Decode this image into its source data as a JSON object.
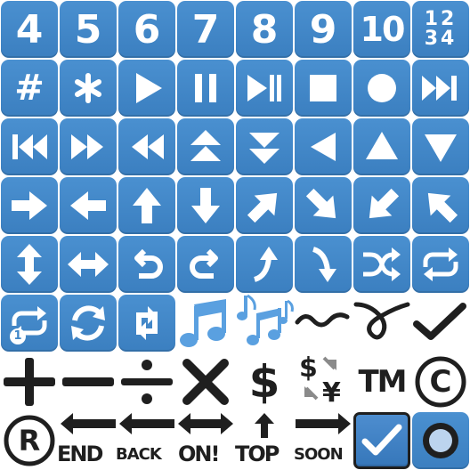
{
  "keycaps": {
    "k4": "4",
    "k5": "5",
    "k6": "6",
    "k7": "7",
    "k8": "8",
    "k9": "9",
    "k10": "10",
    "k1234_a": "12",
    "k1234_b": "34",
    "hash": "#",
    "asterisk": "*"
  },
  "repeat_one_badge": "1",
  "symbols": {
    "tm": "TM",
    "c": "C",
    "r": "R"
  },
  "arrow_words": {
    "end": "END",
    "back": "BACK",
    "on": "ON!",
    "top": "TOP",
    "soon": "SOON"
  },
  "colors": {
    "tile": "#3f86c8",
    "glyph": "#ffffff",
    "dark": "#1f1f1f",
    "note": "#5aa0e0",
    "check": "#4a86c8"
  },
  "icons": [
    "keycap-4",
    "keycap-5",
    "keycap-6",
    "keycap-7",
    "keycap-8",
    "keycap-9",
    "keycap-10",
    "input-numbers",
    "keycap-hash",
    "keycap-asterisk",
    "play",
    "pause",
    "play-pause",
    "stop",
    "record",
    "next-track",
    "previous-track",
    "fast-forward",
    "rewind",
    "fast-up",
    "fast-down",
    "reverse",
    "up-triangle",
    "down-triangle",
    "right-arrow",
    "left-arrow",
    "up-arrow",
    "down-arrow",
    "up-right-arrow",
    "down-right-arrow",
    "down-left-arrow",
    "up-left-arrow",
    "up-down-arrow",
    "left-right-arrow",
    "return-left",
    "return-right",
    "curve-up",
    "curve-down",
    "shuffle",
    "repeat",
    "repeat-one",
    "counterclockwise-arrows",
    "clockwise-arrows",
    "musical-note",
    "musical-notes",
    "wavy-dash",
    "curly-loop",
    "check-mark",
    "plus",
    "minus",
    "divide",
    "multiply",
    "dollar",
    "currency-exchange",
    "trade-mark",
    "copyright",
    "registered",
    "end-arrow",
    "back-arrow",
    "on-arrow",
    "top-arrow",
    "soon-arrow",
    "check-box",
    "radio-button"
  ]
}
